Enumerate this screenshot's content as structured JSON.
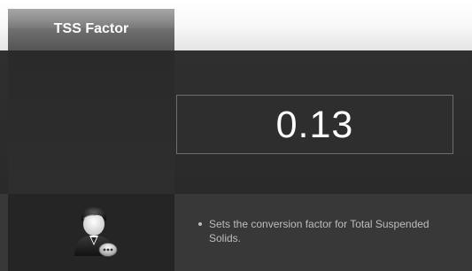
{
  "tab": {
    "title": "TSS Factor"
  },
  "setting": {
    "value": "0.13"
  },
  "help": {
    "description": "Sets the conversion factor for Total Suspended Solids."
  },
  "icons": {
    "help_avatar": "user-support-icon"
  }
}
